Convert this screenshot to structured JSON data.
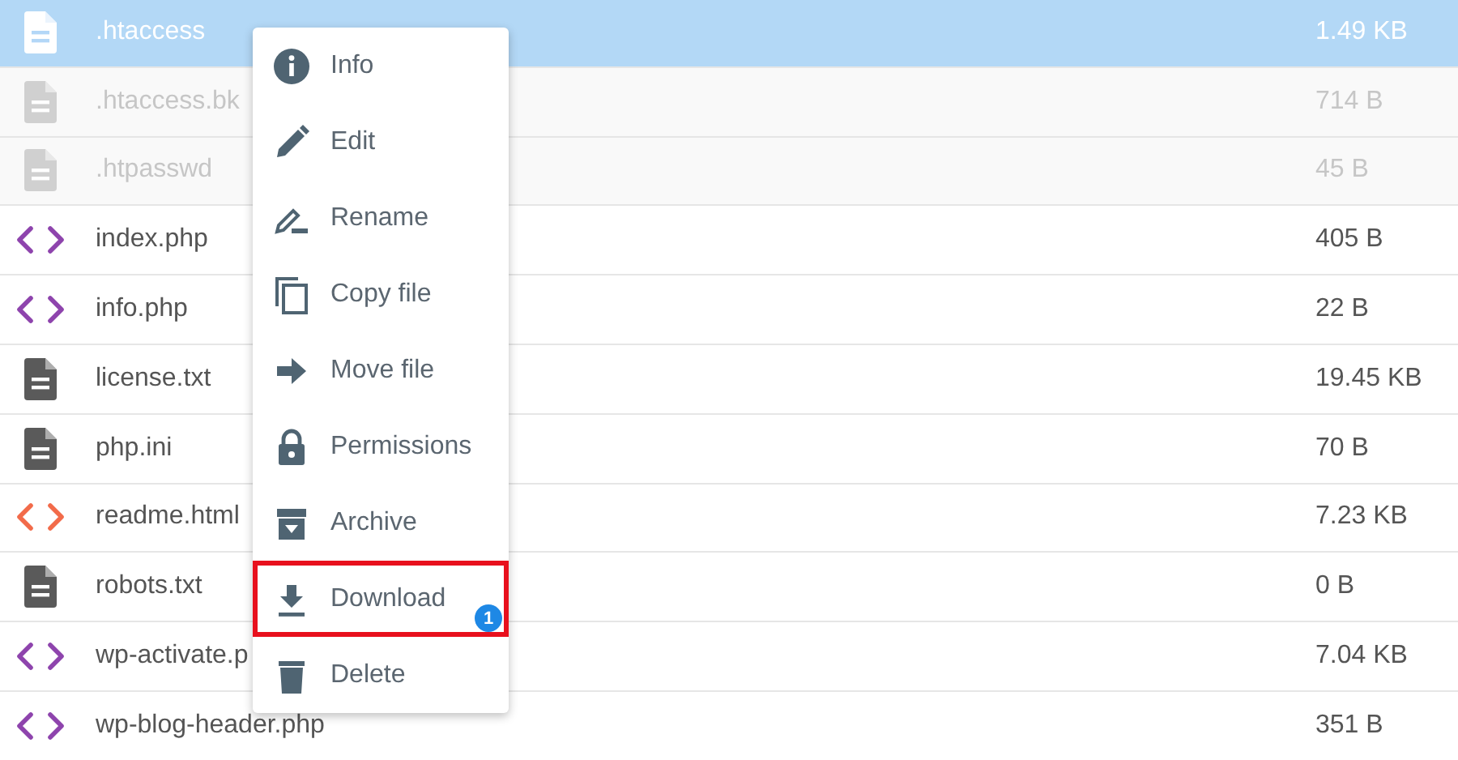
{
  "files": [
    {
      "name": ".htaccess",
      "size": "1.49 KB",
      "kind": "doc",
      "selected": true,
      "hidden": false
    },
    {
      "name": ".htaccess.bk",
      "size": "714 B",
      "kind": "doc",
      "selected": false,
      "hidden": true
    },
    {
      "name": ".htpasswd",
      "size": "45 B",
      "kind": "doc",
      "selected": false,
      "hidden": true
    },
    {
      "name": "index.php",
      "size": "405 B",
      "kind": "code",
      "color": "#8e44ad",
      "selected": false,
      "hidden": false
    },
    {
      "name": "info.php",
      "size": "22 B",
      "kind": "code",
      "color": "#8e44ad",
      "selected": false,
      "hidden": false
    },
    {
      "name": "license.txt",
      "size": "19.45 KB",
      "kind": "doc",
      "selected": false,
      "hidden": false
    },
    {
      "name": "php.ini",
      "size": "70 B",
      "kind": "doc",
      "selected": false,
      "hidden": false
    },
    {
      "name": "readme.html",
      "size": "7.23 KB",
      "kind": "code",
      "color": "#f26b4a",
      "selected": false,
      "hidden": false
    },
    {
      "name": "robots.txt",
      "size": "0 B",
      "kind": "doc",
      "selected": false,
      "hidden": false
    },
    {
      "name": "wp-activate.p",
      "size": "7.04 KB",
      "kind": "code",
      "color": "#8e44ad",
      "selected": false,
      "hidden": false
    },
    {
      "name": "wp-blog-header.php",
      "size": "351 B",
      "kind": "code",
      "color": "#8e44ad",
      "selected": false,
      "hidden": false
    }
  ],
  "context_menu": {
    "items": [
      {
        "label": "Info",
        "kind": "info",
        "highlighted": false
      },
      {
        "label": "Edit",
        "kind": "edit",
        "highlighted": false
      },
      {
        "label": "Rename",
        "kind": "rename",
        "highlighted": false
      },
      {
        "label": "Copy file",
        "kind": "copy",
        "highlighted": false
      },
      {
        "label": "Move file",
        "kind": "move",
        "highlighted": false
      },
      {
        "label": "Permissions",
        "kind": "permissions",
        "highlighted": false
      },
      {
        "label": "Archive",
        "kind": "archive",
        "highlighted": false
      },
      {
        "label": "Download",
        "kind": "download",
        "highlighted": true,
        "badge": "1"
      },
      {
        "label": "Delete",
        "kind": "delete",
        "highlighted": false
      }
    ]
  }
}
